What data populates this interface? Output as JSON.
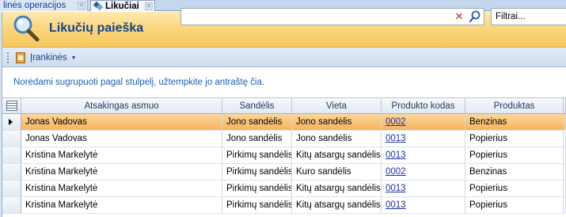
{
  "tabs": [
    {
      "label": "linės operacijos"
    },
    {
      "label": "Likučiai"
    }
  ],
  "header": {
    "title": "Likučių paieška",
    "search_value": "",
    "filter_value": "Filtrai..."
  },
  "toolbar": {
    "tools_label": "Įrankinės"
  },
  "grid": {
    "group_hint": "Norėdami sugrupuoti pagal stulpelį, užtempkite jo antraštę čia.",
    "columns": [
      "Atsakingas asmuo",
      "Sandėlis",
      "Vieta",
      "Produkto kodas",
      "Produktas"
    ],
    "rows": [
      {
        "person": "Jonas  Vadovas",
        "warehouse": "Jono sandėlis",
        "location": "Jono sandėlis",
        "code": "0002",
        "product": "Benzinas"
      },
      {
        "person": "Jonas  Vadovas",
        "warehouse": "Jono sandėlis",
        "location": "Jono sandėlis",
        "code": "0013",
        "product": "Popierius"
      },
      {
        "person": "Kristina Markelytė",
        "warehouse": "Pirkimų sandėlis",
        "location": "Kitų atsargų sandėlis",
        "code": "0013",
        "product": "Popierius"
      },
      {
        "person": "Kristina Markelytė",
        "warehouse": "Pirkimų sandėlis",
        "location": "Kuro sandėlis",
        "code": "0002",
        "product": "Benzinas"
      },
      {
        "person": "Kristina Markelytė",
        "warehouse": "Pirkimų sandėlis",
        "location": "Kitų atsargų sandėlis",
        "code": "0013",
        "product": "Popierius"
      },
      {
        "person": "Kristina Markelytė",
        "warehouse": "Pirkimų sandėlis",
        "location": "Kitų atsargų sandėlis",
        "code": "0013",
        "product": "Popierius"
      }
    ]
  }
}
